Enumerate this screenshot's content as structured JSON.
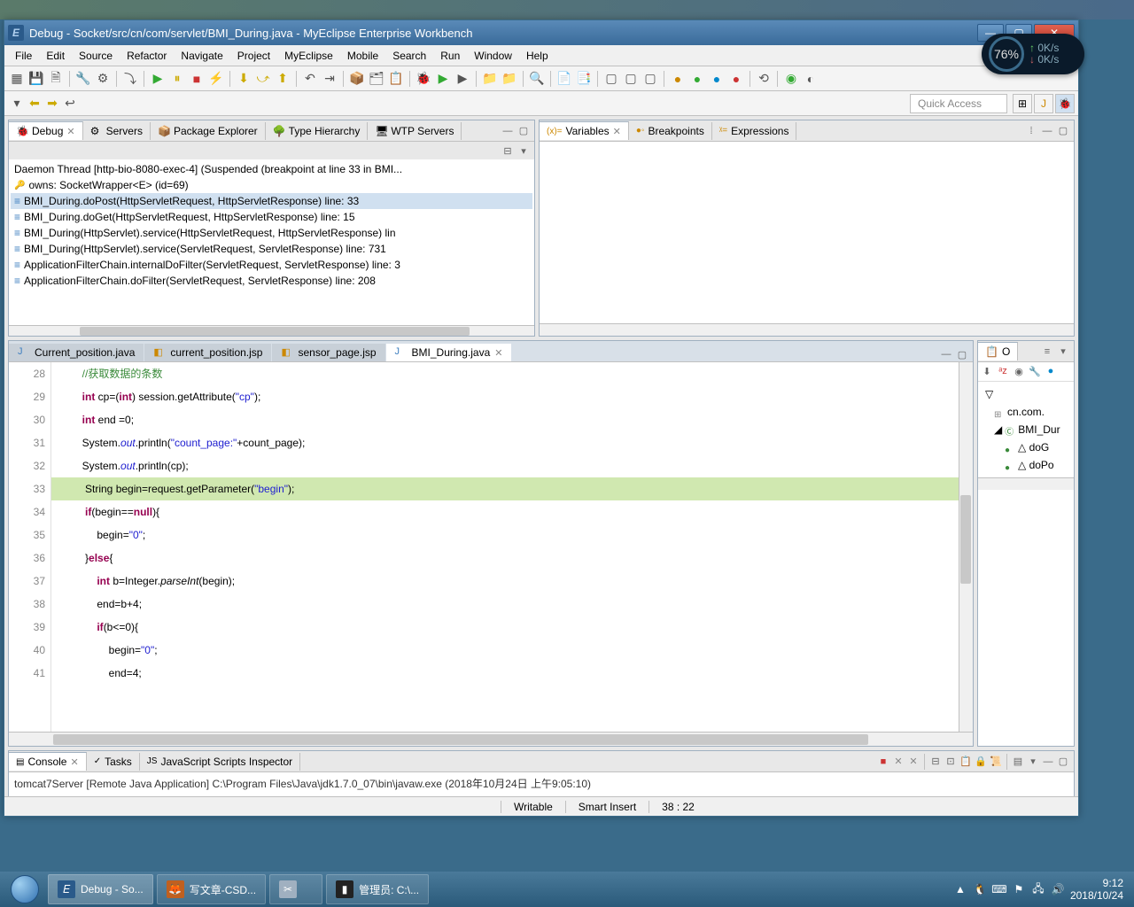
{
  "window": {
    "title": "Debug - Socket/src/cn/com/servlet/BMI_During.java - MyEclipse Enterprise Workbench"
  },
  "menu": [
    "File",
    "Edit",
    "Source",
    "Refactor",
    "Navigate",
    "Project",
    "MyEclipse",
    "Mobile",
    "Search",
    "Run",
    "Window",
    "Help"
  ],
  "quick_access": "Quick Access",
  "debug_panel": {
    "tabs": [
      "Debug",
      "Servers",
      "Package Explorer",
      "Type Hierarchy",
      "WTP Servers"
    ],
    "thread": "Daemon Thread [http-bio-8080-exec-4] (Suspended (breakpoint at line 33 in BMI...",
    "owns": "owns: SocketWrapper<E>  (id=69)",
    "stack": [
      "BMI_During.doPost(HttpServletRequest, HttpServletResponse) line: 33",
      "BMI_During.doGet(HttpServletRequest, HttpServletResponse) line: 15",
      "BMI_During(HttpServlet).service(HttpServletRequest, HttpServletResponse) lin",
      "BMI_During(HttpServlet).service(ServletRequest, ServletResponse) line: 731",
      "ApplicationFilterChain.internalDoFilter(ServletRequest, ServletResponse) line: 3",
      "ApplicationFilterChain.doFilter(ServletRequest, ServletResponse) line: 208"
    ]
  },
  "vars_panel": {
    "tabs": [
      "Variables",
      "Breakpoints",
      "Expressions"
    ]
  },
  "editor": {
    "tabs": [
      {
        "label": "Current_position.java",
        "icon": "J"
      },
      {
        "label": "current_position.jsp",
        "icon": "jsp"
      },
      {
        "label": "sensor_page.jsp",
        "icon": "jsp"
      },
      {
        "label": "BMI_During.java",
        "icon": "J",
        "active": true
      }
    ],
    "lines": [
      {
        "n": 28,
        "html": "        <span class='com'>//获取数据的条数</span>"
      },
      {
        "n": 29,
        "html": "        <span class='kw'>int</span> cp=(<span class='kw'>int</span>) session.getAttribute(<span class='str'>\"cp\"</span>);"
      },
      {
        "n": 30,
        "html": "        <span class='kw'>int</span> end =0;"
      },
      {
        "n": 31,
        "html": "        System.<span class='fld'>out</span>.println(<span class='str'>\"count_page:\"</span>+count_page);"
      },
      {
        "n": 32,
        "html": "        System.<span class='fld'>out</span>.println(cp);"
      },
      {
        "n": 33,
        "html": "         String begin=request.getParameter(<span class='str'>\"begin\"</span>);",
        "hl": true
      },
      {
        "n": 34,
        "html": "         <span class='kw'>if</span>(begin==<span class='kw'>null</span>){"
      },
      {
        "n": 35,
        "html": "             begin=<span class='str'>\"0\"</span>;"
      },
      {
        "n": 36,
        "html": "         }<span class='kw'>else</span>{"
      },
      {
        "n": 37,
        "html": "             <span class='kw'>int</span> b=Integer.<span class='mtd'>parseInt</span>(begin);"
      },
      {
        "n": 38,
        "html": "             end=b+4;"
      },
      {
        "n": 39,
        "html": "             <span class='kw'>if</span>(b<=0){"
      },
      {
        "n": 40,
        "html": "                 begin=<span class='str'>\"0\"</span>;"
      },
      {
        "n": 41,
        "html": "                 end=4;"
      }
    ]
  },
  "outline": {
    "title": "O",
    "items": [
      {
        "label": "cn.com.",
        "indent": 1,
        "icon": "pkg"
      },
      {
        "label": "BMI_Dur",
        "indent": 1,
        "icon": "class",
        "expanded": true
      },
      {
        "label": "doG",
        "indent": 2,
        "icon": "method"
      },
      {
        "label": "doPo",
        "indent": 2,
        "icon": "method"
      }
    ]
  },
  "console": {
    "tabs": [
      "Console",
      "Tasks",
      "JavaScript Scripts Inspector"
    ],
    "text": "tomcat7Server [Remote Java Application] C:\\Program Files\\Java\\jdk1.7.0_07\\bin\\javaw.exe (2018年10月24日 上午9:05:10)"
  },
  "status": {
    "writable": "Writable",
    "insert": "Smart Insert",
    "pos": "38 : 22"
  },
  "taskbar": {
    "items": [
      {
        "label": "Debug - So...",
        "icon": "E",
        "active": true
      },
      {
        "label": "写文章-CSD...",
        "icon": "F"
      },
      {
        "label": "",
        "icon": "S"
      },
      {
        "label": "管理员: C:\\...",
        "icon": "C"
      }
    ],
    "clock_time": "9:12",
    "clock_date": "2018/10/24"
  },
  "net": {
    "pct": "76%",
    "up": "0K/s",
    "down": "0K/s"
  }
}
